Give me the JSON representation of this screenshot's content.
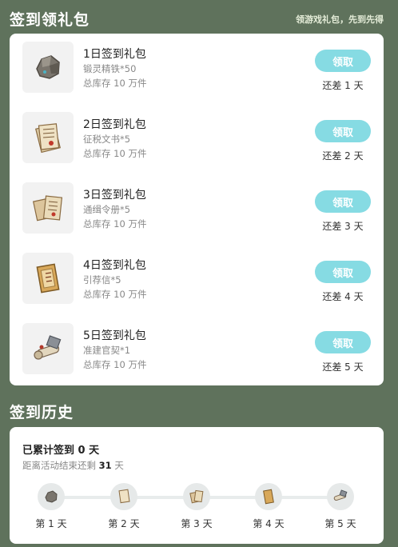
{
  "header": {
    "title": "签到领礼包",
    "hint": "领游戏礼包，先到先得"
  },
  "gifts": [
    {
      "name": "1日签到礼包",
      "item": "锻灵精铁*50",
      "stock": "总库存 10 万件",
      "button": "领取",
      "remain": "还差 1 天",
      "icon": "ore-rock-icon"
    },
    {
      "name": "2日签到礼包",
      "item": "征税文书*5",
      "stock": "总库存 10 万件",
      "button": "领取",
      "remain": "还差 2 天",
      "icon": "tax-document-icon"
    },
    {
      "name": "3日签到礼包",
      "item": "通缉令册*5",
      "stock": "总库存 10 万件",
      "button": "领取",
      "remain": "还差 3 天",
      "icon": "wanted-book-icon"
    },
    {
      "name": "4日签到礼包",
      "item": "引荐信*5",
      "stock": "总库存 10 万件",
      "button": "领取",
      "remain": "还差 4 天",
      "icon": "letter-icon"
    },
    {
      "name": "5日签到礼包",
      "item": "准建官契*1",
      "stock": "总库存 10 万件",
      "button": "领取",
      "remain": "还差 5 天",
      "icon": "scroll-icon"
    }
  ],
  "history": {
    "title": "签到历史",
    "total_prefix": "已累计签到",
    "total_count": "0",
    "total_suffix": "天",
    "left_prefix": "距离活动结束还剩",
    "left_days": "31",
    "left_suffix": "天",
    "days": [
      "第 1 天",
      "第 2 天",
      "第 3 天",
      "第 4 天",
      "第 5 天"
    ]
  },
  "colors": {
    "background": "#5f725c",
    "button": "#86dbe3",
    "card": "#ffffff"
  }
}
